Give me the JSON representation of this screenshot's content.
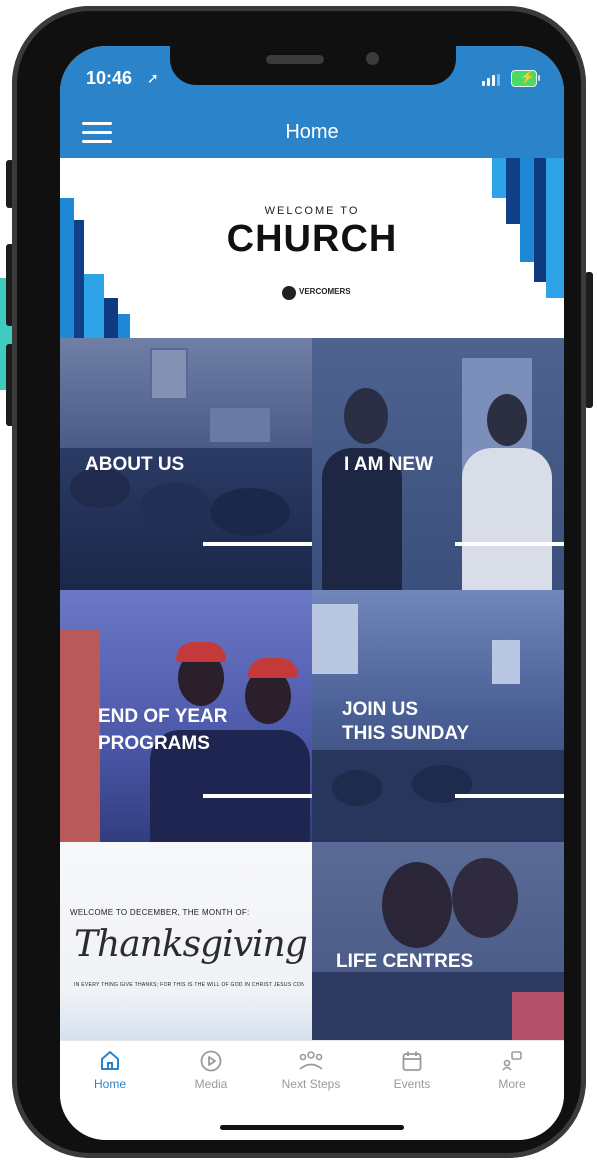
{
  "status_bar": {
    "time": "10:46"
  },
  "header": {
    "title": "Home"
  },
  "banner": {
    "welcome_text": "WELCOME TO",
    "main_text": "CHURCH",
    "logo_text": "VERCOMERS"
  },
  "tiles": [
    {
      "label": "ABOUT US"
    },
    {
      "label": "I AM NEW"
    },
    {
      "label_line1": "END OF YEAR",
      "label_line2": "PROGRAMS"
    },
    {
      "label_line1": "JOIN US",
      "label_line2": "THIS SUNDAY"
    },
    {
      "top_text": "WELCOME TO DECEMBER, THE MONTH OF:",
      "script_text": "Thanksgiving",
      "bottom_text": "IN EVERY THING GIVE THANKS; FOR THIS IS THE WILL OF GOD IN CHRIST JESUS CONCERNING YOU."
    },
    {
      "label": "LIFE CENTRES"
    }
  ],
  "tab_bar": {
    "tabs": [
      {
        "label": "Home",
        "icon": "home-icon",
        "active": true
      },
      {
        "label": "Media",
        "icon": "play-circle-icon",
        "active": false
      },
      {
        "label": "Next Steps",
        "icon": "group-icon",
        "active": false
      },
      {
        "label": "Events",
        "icon": "calendar-icon",
        "active": false
      },
      {
        "label": "More",
        "icon": "more-icon",
        "active": false
      }
    ]
  },
  "colors": {
    "brand_blue": "#2b84c9",
    "tab_active": "#2b84c9",
    "tab_inactive": "#9a9a9a",
    "accent_teal": "#3fcbc0"
  }
}
